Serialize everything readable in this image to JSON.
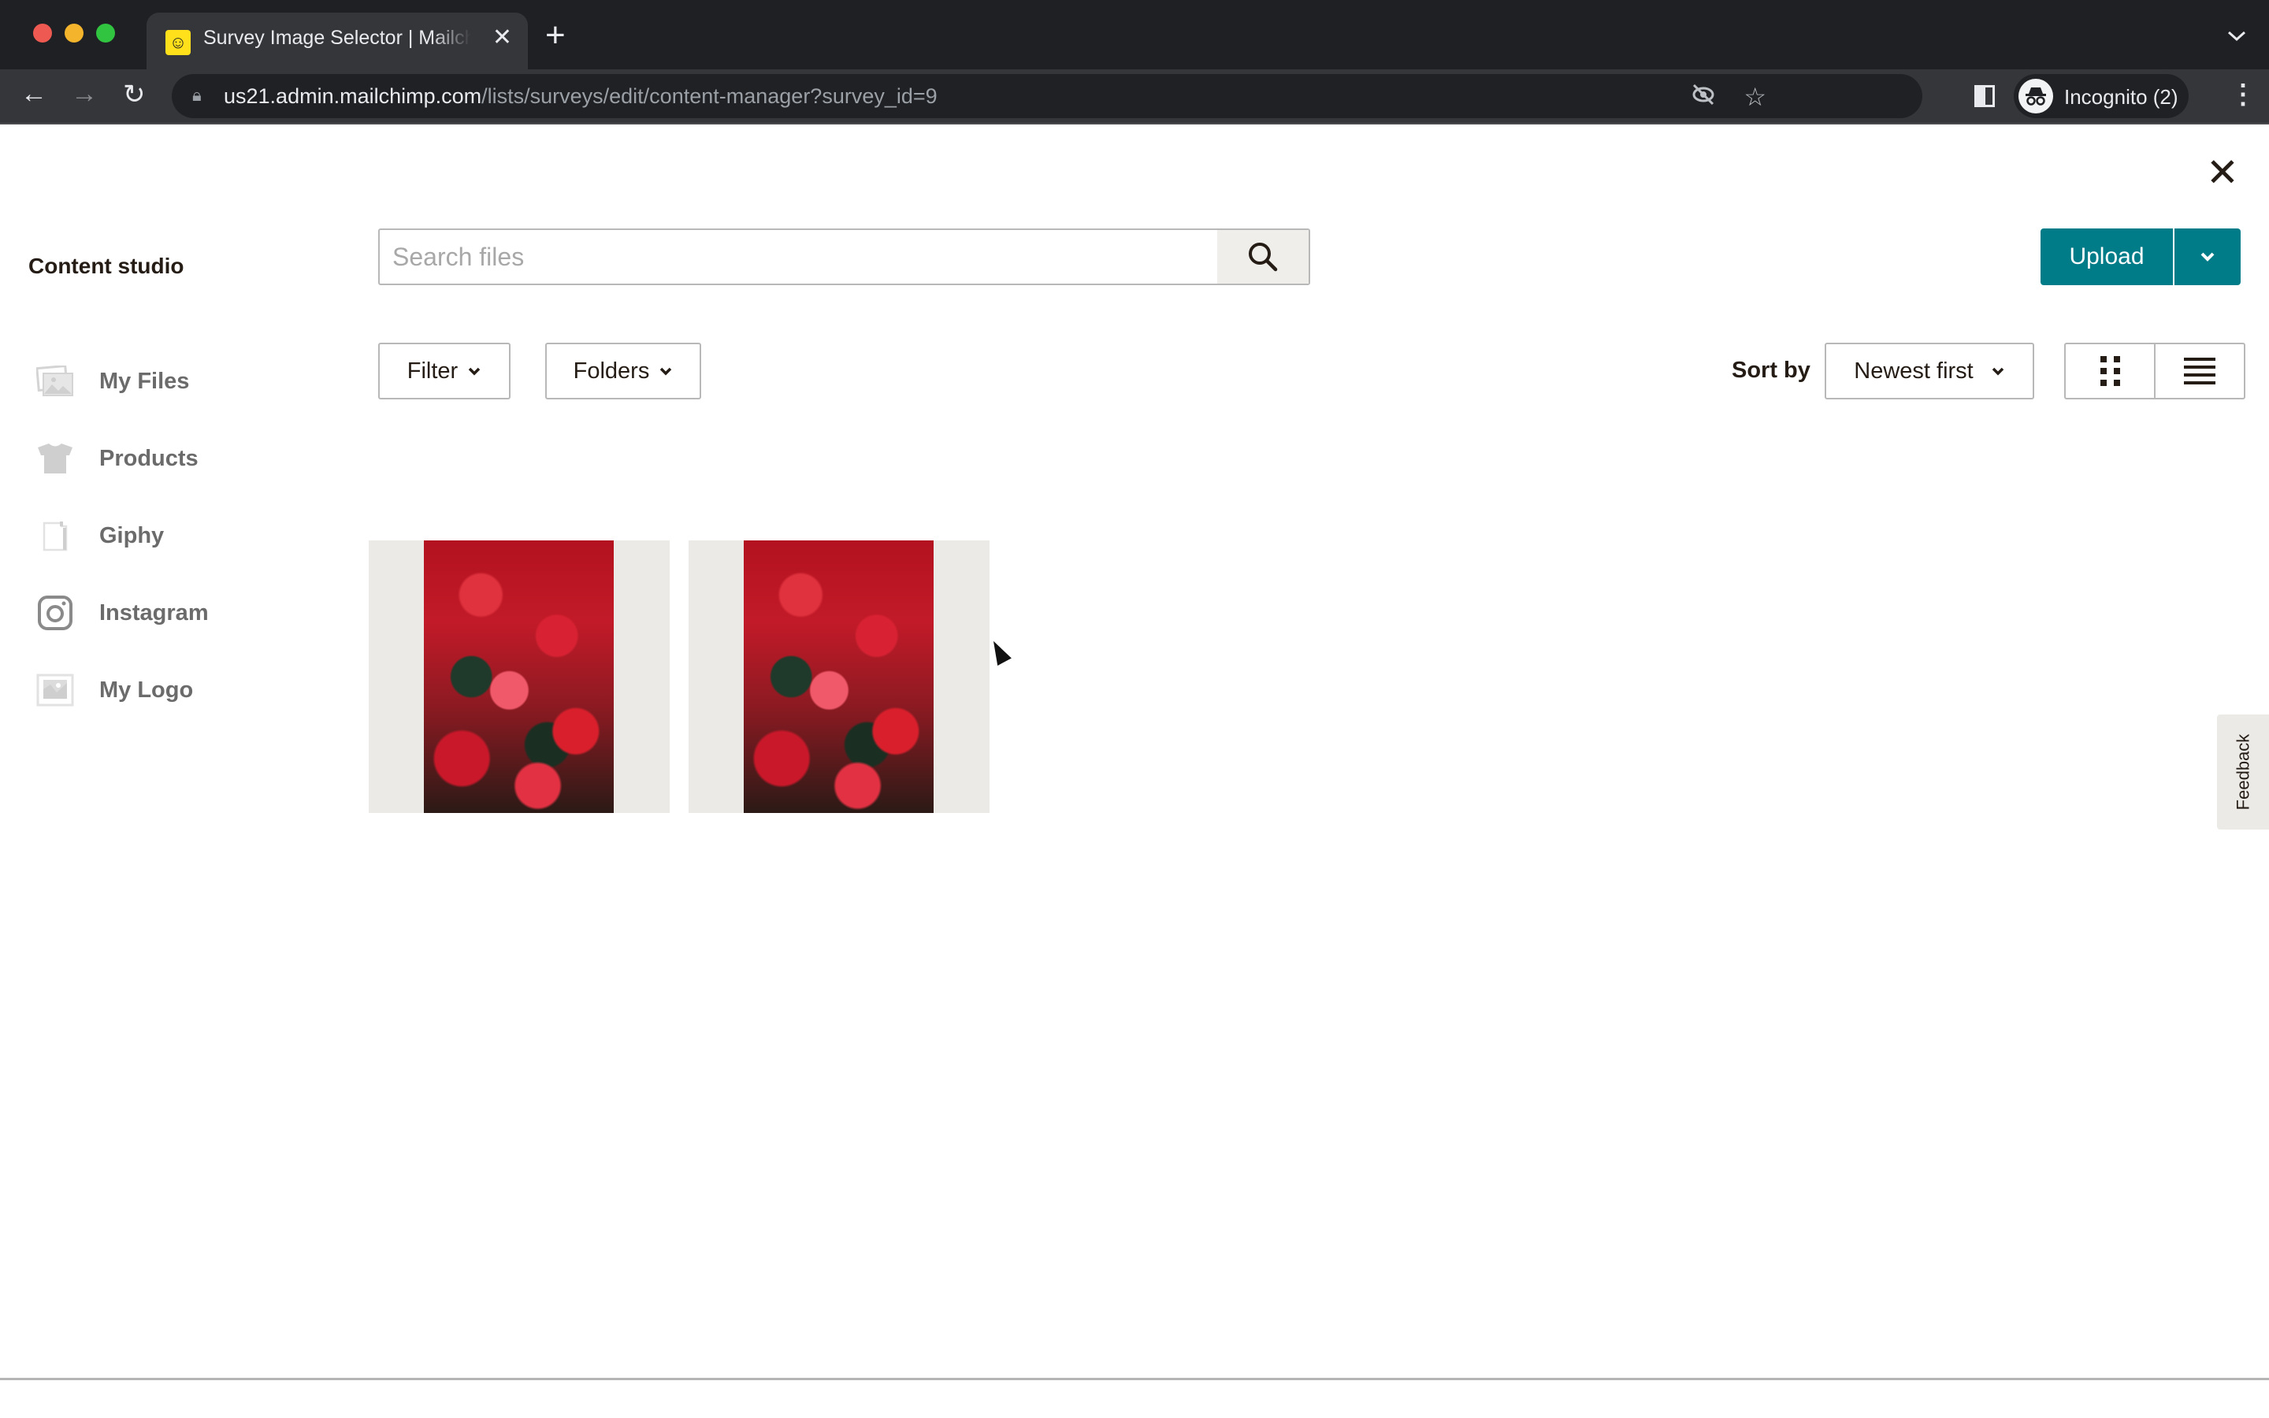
{
  "browser": {
    "tab_title": "Survey Image Selector | Mailchimp",
    "tab_close_glyph": "✕",
    "new_tab_glyph": "+",
    "tab_menu_glyph": "⌄",
    "url_host": "us21.admin.mailchimp.com",
    "url_path": "/lists/surveys/edit/content-manager?survey_id=9",
    "profile_label": "Incognito (2)",
    "back_glyph": "←",
    "forward_glyph": "→",
    "reload_glyph": "↻",
    "menu_glyph": "⋮"
  },
  "modal": {
    "close_glyph": "✕",
    "sidebar_title": "Content studio",
    "sidebar_items": [
      {
        "label": "My Files",
        "icon": "images-icon"
      },
      {
        "label": "Products",
        "icon": "tshirt-icon"
      },
      {
        "label": "Giphy",
        "icon": "giphy-icon"
      },
      {
        "label": "Instagram",
        "icon": "instagram-icon"
      },
      {
        "label": "My Logo",
        "icon": "logo-image-icon"
      }
    ],
    "search": {
      "placeholder": "Search files",
      "value": ""
    },
    "filter_label": "Filter",
    "folders_label": "Folders",
    "upload_label": "Upload",
    "sort_label": "Sort by",
    "sort_value": "Newest first",
    "view_modes": [
      "grid",
      "list"
    ],
    "active_view": "grid",
    "files": [
      {
        "type": "image",
        "description": "red begonia flowers"
      },
      {
        "type": "image",
        "description": "red begonia flowers"
      }
    ],
    "feedback_label": "Feedback",
    "accent_color": "#007c89"
  }
}
